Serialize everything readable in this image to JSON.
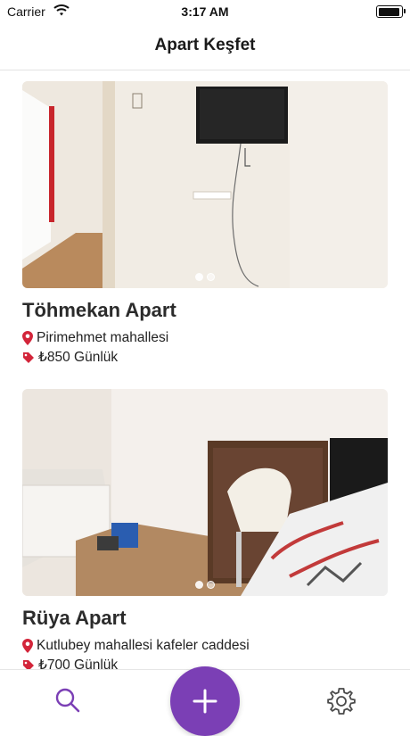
{
  "status_bar": {
    "carrier": "Carrier",
    "time": "3:17 AM"
  },
  "header": {
    "title": "Apart Keşfet"
  },
  "listings": [
    {
      "name": "Töhmekan Apart",
      "location": "Pirimehmet mahallesi",
      "price": "₺850 Günlük",
      "photo_count": 2,
      "active_photo": 0
    },
    {
      "name": "Rüya Apart",
      "location": "Kutlubey mahallesi kafeler caddesi",
      "price": "₺700 Günlük",
      "photo_count": 2,
      "active_photo": 0
    }
  ],
  "tabbar": {
    "items": [
      {
        "icon": "search-icon"
      },
      {
        "icon": "plus-icon"
      },
      {
        "icon": "gear-icon"
      }
    ]
  },
  "colors": {
    "accent": "#7b3fb5",
    "location_pin": "#d3253a",
    "price_tag": "#d3253a"
  }
}
